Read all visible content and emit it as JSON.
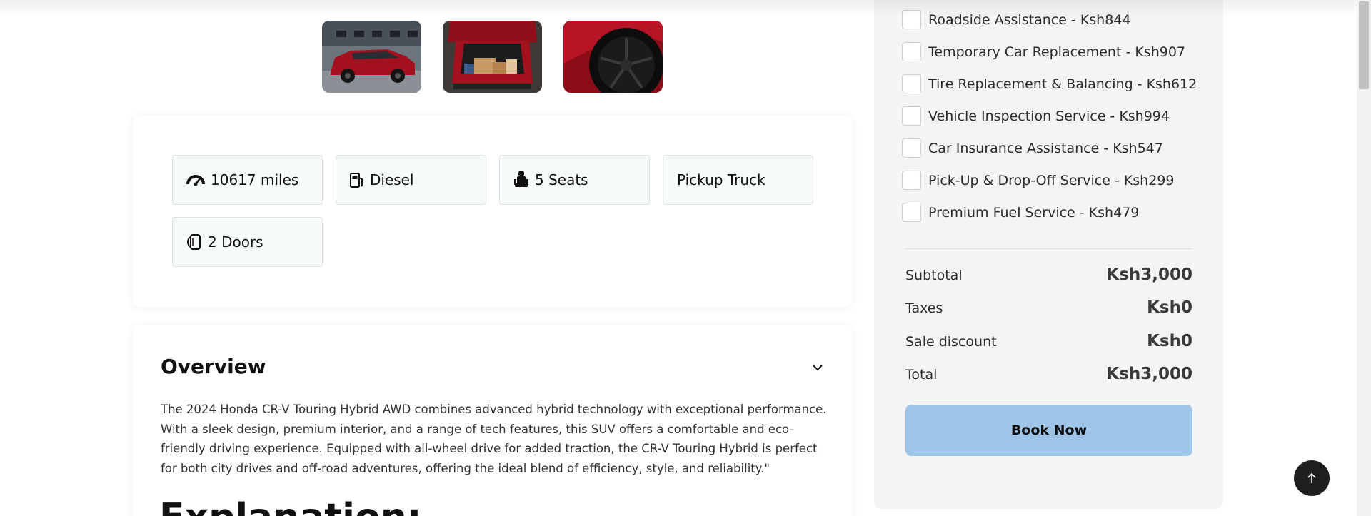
{
  "gallery": {
    "images": [
      {
        "alt": "red-suv-front-thumbnail"
      },
      {
        "alt": "red-suv-trunk-thumbnail"
      },
      {
        "alt": "black-wheel-thumbnail"
      }
    ]
  },
  "features": {
    "mileage": {
      "label": "10617 miles",
      "icon": "speedometer-icon"
    },
    "fuel": {
      "label": "Diesel",
      "icon": "fuel-pump-icon"
    },
    "seats": {
      "label": "5 Seats",
      "icon": "car-seat-icon"
    },
    "body": {
      "label": "Pickup Truck"
    },
    "doors": {
      "label": "2 Doors",
      "icon": "car-door-icon"
    }
  },
  "overview": {
    "title": "Overview",
    "text": "The 2024 Honda CR-V Touring Hybrid AWD combines advanced hybrid technology with exceptional performance. With a sleek design, premium interior, and a range of tech features, this SUV offers a comfortable and eco-friendly driving experience. Equipped with all-wheel drive for added traction, the CR-V Touring Hybrid is perfect for both city drives and off-road adventures, offering the ideal blend of efficiency, style, and reliability.\"",
    "next_heading": "Explanation:"
  },
  "services": [
    {
      "label": "Roadside Assistance - Ksh844",
      "checked": false
    },
    {
      "label": "Temporary Car Replacement - Ksh907",
      "checked": false
    },
    {
      "label": "Tire Replacement & Balancing - Ksh612",
      "checked": false
    },
    {
      "label": "Vehicle Inspection Service - Ksh994",
      "checked": false
    },
    {
      "label": "Car Insurance Assistance - Ksh547",
      "checked": false
    },
    {
      "label": "Pick-Up & Drop-Off Service - Ksh299",
      "checked": false
    },
    {
      "label": "Premium Fuel Service - Ksh479",
      "checked": false
    }
  ],
  "summary": {
    "subtotal_label": "Subtotal",
    "subtotal_value": "Ksh3,000",
    "taxes_label": "Taxes",
    "taxes_value": "Ksh0",
    "discount_label": "Sale discount",
    "discount_value": "Ksh0",
    "total_label": "Total",
    "total_value": "Ksh3,000"
  },
  "book_button": "Book Now",
  "colors": {
    "book_button_bg": "#9ec5e8",
    "feature_chip_bg": "#f6fbf8",
    "sidebar_bg": "#f4f4f4",
    "to_top_bg": "#1f1f1f"
  }
}
